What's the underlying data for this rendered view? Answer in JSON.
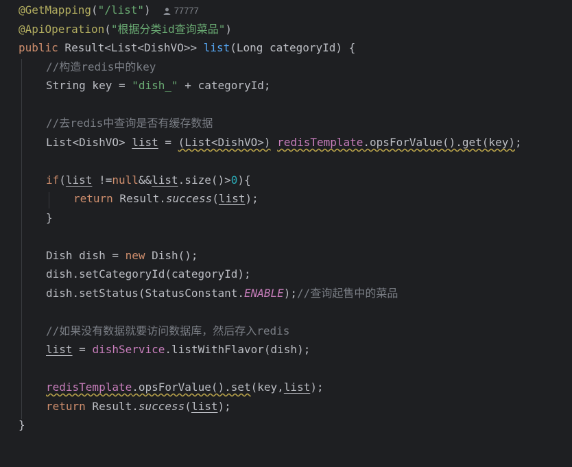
{
  "colors": {
    "background": "#1e1f22",
    "annotation": "#b3ae60",
    "string": "#6aab73",
    "keyword": "#cf8e6d",
    "method": "#56a8f5",
    "comment": "#7a7e85",
    "number": "#2aacb8",
    "field": "#c77dbb",
    "text": "#bcbec4"
  },
  "usage_hint": {
    "icon": "user-icon",
    "author": "77777"
  },
  "code": {
    "l1": {
      "ann": "@GetMapping",
      "open": "(",
      "str": "\"/list\"",
      "close": ")"
    },
    "l2": {
      "ann": "@ApiOperation",
      "open": "(",
      "str": "\"根据分类id查询菜品\"",
      "close": ")"
    },
    "l3": {
      "kw": "public",
      "type": " Result<List<DishVO>> ",
      "fn": "list",
      "rest": "(Long categoryId) {"
    },
    "l4": {
      "comment": "//构造redis中的key"
    },
    "l5": {
      "pre": "String key = ",
      "str": "\"dish_\"",
      "post": " + categoryId;"
    },
    "l6": {
      "comment": "//去redis中查询是否有缓存数据"
    },
    "l7": {
      "pre": "List<DishVO> ",
      "var": "list",
      "eq": " = ",
      "cast": "(List<DishVO>)",
      "sp": " ",
      "fld": "redisTemplate",
      "call": ".opsForValue().get(key)",
      "end": ";"
    },
    "l8": {
      "kw": "if",
      "p1": "(",
      "var1": "list",
      "p2": " !=",
      "kw2": "null",
      "p3": "&&",
      "var2": "list",
      "p4": ".size()>",
      "num": "0",
      "p5": "){"
    },
    "l9": {
      "kw": "return",
      "p1": " Result.",
      "method": "success",
      "p2": "(",
      "var": "list",
      "p3": ");"
    },
    "l10": {
      "text": "}"
    },
    "l11": {
      "pre": "Dish dish = ",
      "kw": "new",
      "post": " Dish();"
    },
    "l12": {
      "text": "dish.setCategoryId(categoryId);"
    },
    "l13": {
      "pre": "dish.setStatus(StatusConstant.",
      "const": "ENABLE",
      "post": ");",
      "comment": "//查询起售中的菜品"
    },
    "l14": {
      "comment": "//如果没有数据就要访问数据库，然后存入redis"
    },
    "l15": {
      "var": "list",
      "eq": " = ",
      "fld": "dishService",
      "post": ".listWithFlavor(dish);"
    },
    "l16": {
      "fld": "redisTemplate",
      "call": ".opsForValue().set",
      "p1": "(key,",
      "var": "list",
      "p2": ");"
    },
    "l17": {
      "kw": "return",
      "p1": " Result.",
      "method": "success",
      "p2": "(",
      "var": "list",
      "p3": ");"
    },
    "l18": {
      "text": "}"
    }
  }
}
